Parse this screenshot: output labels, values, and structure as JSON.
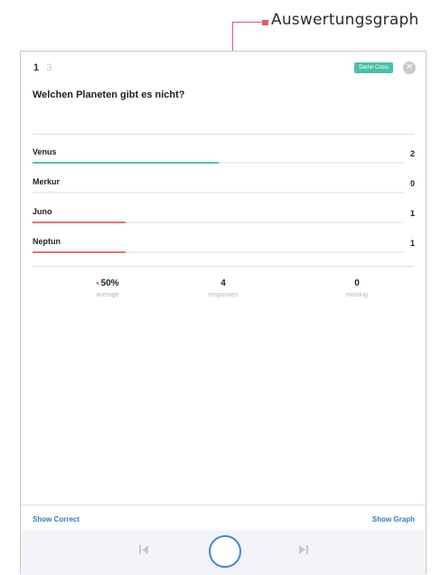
{
  "annotation": {
    "label": "Auswertungsgraph"
  },
  "header": {
    "page_current": "1",
    "page_other": "3",
    "class_badge": "Demo Class"
  },
  "question": "Welchen Planeten gibt es nicht?",
  "answers": [
    {
      "label": "Venus",
      "count": "2",
      "fraction": 0.5,
      "color": "#5bc3a7"
    },
    {
      "label": "Merkur",
      "count": "0",
      "fraction": 0.0,
      "color": "#e77178"
    },
    {
      "label": "Juno",
      "count": "1",
      "fraction": 0.25,
      "color": "#e77178"
    },
    {
      "label": "Neptun",
      "count": "1",
      "fraction": 0.25,
      "color": "#e77178"
    }
  ],
  "stats": [
    {
      "value": "50%",
      "label": "average"
    },
    {
      "value": "4",
      "label": "responses"
    },
    {
      "value": "0",
      "label": "missing"
    }
  ],
  "footer": {
    "show_correct": "Show Correct",
    "show_graph": "Show Graph"
  },
  "colors": {
    "accent": "#3a77b4",
    "badge": "#4cc0a8",
    "highlight": "#e05a63"
  }
}
